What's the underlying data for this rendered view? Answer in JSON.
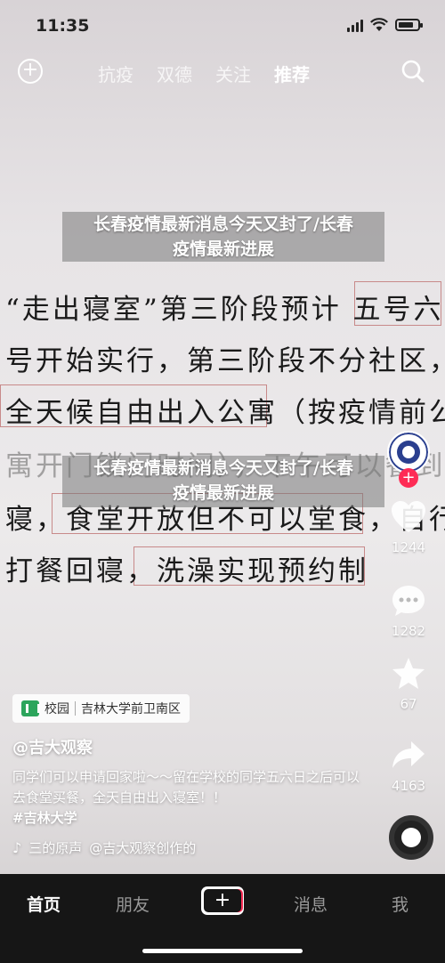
{
  "status_bar": {
    "time": "11:35"
  },
  "top_nav": {
    "tabs": [
      {
        "label": "抗疫",
        "active": false
      },
      {
        "label": "双德",
        "active": false
      },
      {
        "label": "关注",
        "active": false
      },
      {
        "label": "推荐",
        "active": true
      }
    ],
    "add_icon": "plus-circle-icon",
    "search_icon": "search-icon"
  },
  "video": {
    "handwriting_lines": [
      "“走出寝室”第三阶段预计 五号六",
      "号开始实行，第三阶段不分社区，",
      "全天候自由出入公寓（按疫情前公",
      "寓开门锁门时间），下午可以餐到",
      "寝，食堂开放但不可以堂食，自行",
      "打餐回寝，洗澡实现预约制"
    ],
    "overlay_headline": {
      "line1": "长春疫情最新消息今天又封了/长春",
      "line2": "疫情最新进展"
    },
    "overlay_headline_bottom": {
      "line1": "长春疫情最新消息今天又封了/长春",
      "line2": "疫情最新进展"
    }
  },
  "right_rail": {
    "likes": "1244",
    "comments": "1282",
    "favorites": "67",
    "shares": "4163",
    "avatar_label": "JILIN UNIVERSITY"
  },
  "info": {
    "location_tag": "校园",
    "location_name": "吉林大学前卫南区",
    "author": "@吉大观察",
    "caption": "同学们可以申请回家啦～～留在学校的同学五六日之后可以去食堂买餐，全天自由出入寝室！！",
    "hashtag": "#吉林大学",
    "music_prefix": "三的原声",
    "music_author": "@吉大观察创作的"
  },
  "tab_bar": {
    "items": [
      {
        "label": "首页",
        "active": true
      },
      {
        "label": "朋友",
        "active": false
      },
      {
        "label": "消息",
        "active": false
      },
      {
        "label": "我",
        "active": false
      }
    ],
    "create_label": "+"
  },
  "colors": {
    "accent_red": "#fe2c55",
    "accent_cyan": "#25f4ee",
    "location_green": "#2ca55c"
  }
}
